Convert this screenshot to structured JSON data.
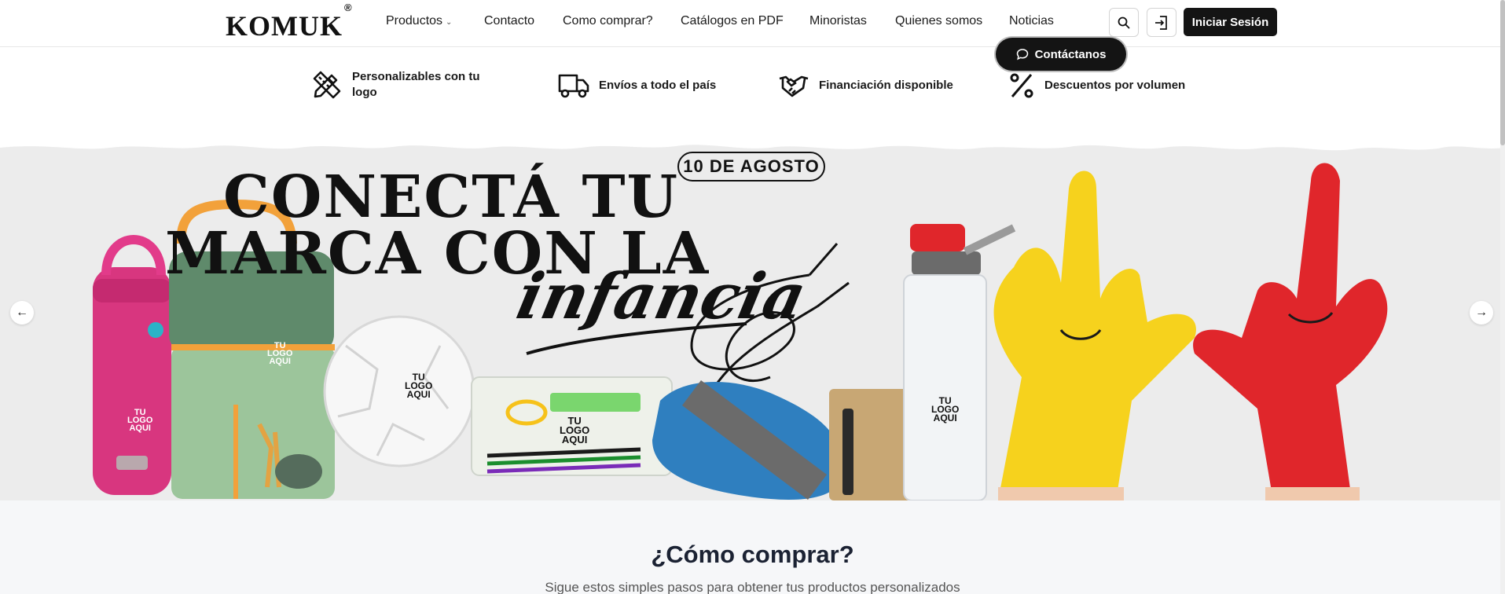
{
  "header": {
    "brand": "KOMUK",
    "brand_mark": "®",
    "nav": [
      {
        "label": "Productos",
        "has_dropdown": true
      },
      {
        "label": "Contacto"
      },
      {
        "label": "Como comprar?"
      },
      {
        "label": "Catálogos en PDF"
      },
      {
        "label": "Minoristas"
      },
      {
        "label": "Quienes somos"
      },
      {
        "label": "Noticias"
      }
    ],
    "search_icon": "search-icon",
    "login_icon": "login-icon",
    "login_label": "Iniciar Sesión"
  },
  "contact_pill": {
    "label": "Contáctanos",
    "icon": "chat-bubble-icon"
  },
  "benefits": [
    {
      "icon": "pencil-ruler-icon",
      "label_line1": "Personalizables con tu",
      "label_line2": "logo"
    },
    {
      "icon": "truck-icon",
      "label_line1": "Envíos a todo el país",
      "label_line2": ""
    },
    {
      "icon": "handshake-icon",
      "label_line1": "Financiación disponible",
      "label_line2": ""
    },
    {
      "icon": "percent-icon",
      "label_line1": "Descuentos por volumen",
      "label_line2": ""
    }
  ],
  "hero": {
    "date": "10 DE AGOSTO",
    "headline_line1": "CONECTÁ TU",
    "headline_line2": "MARCA CON LA",
    "script_word": "infancia",
    "product_stamp": [
      "TU",
      "LOGO",
      "AQUI"
    ],
    "prev_icon": "arrow-left-icon",
    "next_icon": "arrow-right-icon",
    "colors": {
      "background": "#ececec",
      "pink": "#e23b8a",
      "green": "#5f8a6b",
      "blue": "#2f7fbf",
      "yellow": "#f6d21d",
      "red": "#e0262b"
    }
  },
  "how_to_buy": {
    "title": "¿Cómo comprar?",
    "subtitle": "Sigue estos simples pasos para obtener tus productos personalizados"
  }
}
